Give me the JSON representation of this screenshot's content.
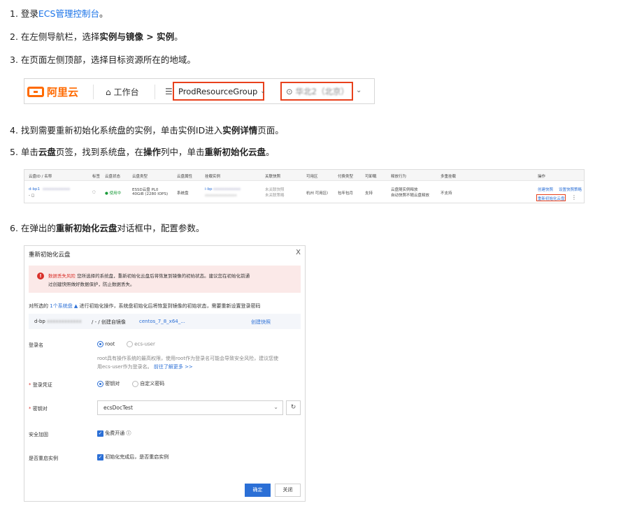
{
  "steps": {
    "s1_prefix": "1. 登录",
    "s1_link": "ECS管理控制台",
    "s1_suffix": "。",
    "s2_prefix": "2. 在左侧导航栏，选择",
    "s2_bold": "实例与镜像 > 实例",
    "s2_suffix": "。",
    "s3": "3. 在页面左侧顶部，选择目标资源所在的地域。",
    "s4_prefix": "4. 找到需要重新初始化系统盘的实例，单击实例ID进入",
    "s4_bold": "实例详情",
    "s4_suffix": "页面。",
    "s5_p1": "5. 单击",
    "s5_b1": "云盘",
    "s5_p2": "页签，找到系统盘，在",
    "s5_b2": "操作",
    "s5_p3": "列中，单击",
    "s5_b3": "重新初始化云盘",
    "s5_p4": "。",
    "s6_prefix": "6. 在弹出的",
    "s6_bold": "重新初始化云盘",
    "s6_suffix": "对话框中，配置参数。"
  },
  "console_header": {
    "logo_text": "阿里云",
    "workbench": "工作台",
    "resource_group": "ProdResourceGroup",
    "region": "华北2（北京）"
  },
  "instance_table": {
    "headers": [
      "云盘ID / 名称",
      "标签",
      "云盘状态",
      "云盘类型",
      "云盘属性",
      "挂载实例",
      "关联快照",
      "可用区",
      "付费类型",
      "可卸载",
      "释放行为",
      "多重挂载",
      "操作"
    ],
    "row": {
      "disk_id": "d-bp1",
      "status": "使用中",
      "type_line1": "ESSD云盘 PL0",
      "type_line2": "40GiB (2280 IOPS)",
      "attribute": "系统盘",
      "instance": "i-bp",
      "snapshot_line1": "未关联快照",
      "snapshot_line2": "未关联策略",
      "zone": "杭州 可用区I",
      "billing": "包年包月",
      "detachable": "支持",
      "release_line1": "云盘随实例释放",
      "release_line2": "自动快照不随云盘释放",
      "multi_attach": "不支持",
      "op1": "创建快照",
      "op2": "设置快照策略",
      "op3": "重新初始化云盘",
      "op_more": "⋮"
    }
  },
  "dialog": {
    "title": "重新初始化云盘",
    "close": "X",
    "alert_risk": "数据丢失风险",
    "alert_line1": "您所选择的系统盘，重新初始化云盘后将恢复到镜像的初始状态。建议您在初始化前通",
    "alert_line2": "过创建快照做好数据保护，防止数据丢失。",
    "info_prefix": "对所选的",
    "info_link": "1个系统盘 ▲",
    "info_suffix": "进行初始化操作，系统盘初始化后将恢复到镜像的初始状态，需要重新设置登录密码",
    "disk_id": "d-bp",
    "disk_mid": "/ - / 创建自镜像",
    "disk_image": "centos_7_8_x64_...",
    "create_snapshot": "创建快照",
    "login_label": "登录名",
    "login_root": "root",
    "login_ecs_user": "ecs-user",
    "login_note1": "root具有操作系统的最高权限，使用root作为登录名可能会导致安全风险，建议您使",
    "login_note2": "用ecs-user作为登录名。",
    "login_note_link": "前往了解更多 >>",
    "cred_label": "登录凭证",
    "cred_keypair": "密钥对",
    "cred_custom": "自定义密码",
    "keypair_label": "密钥对",
    "keypair_value": "ecsDocTest",
    "security_label": "安全加固",
    "security_option": "免费开通 ⓘ",
    "restart_label": "是否重启实例",
    "restart_option": "初始化完成后，是否重启实例",
    "btn_ok": "确定",
    "btn_close": "关闭"
  }
}
